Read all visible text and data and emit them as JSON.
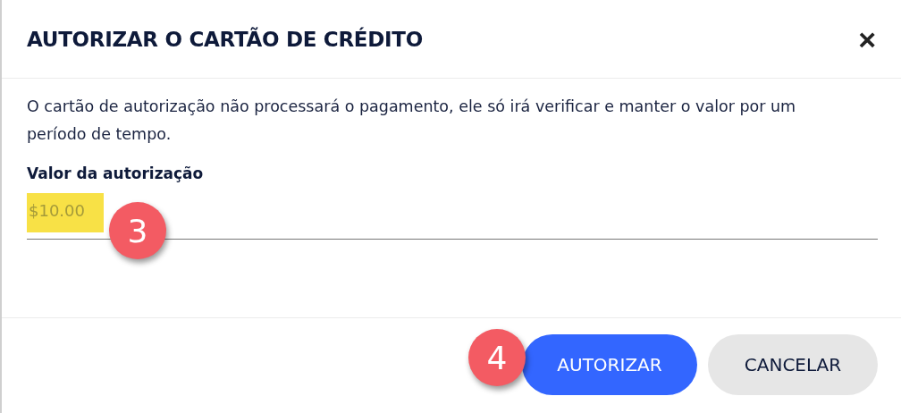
{
  "dialog": {
    "title": "AUTORIZAR O CARTÃO DE CRÉDITO",
    "close": "×"
  },
  "description": "O cartão de autorização não processará o pagamento, ele só irá verificar e manter o valor por um período de tempo.",
  "amount_field": {
    "label": "Valor da autorização",
    "placeholder": "$10.00",
    "highlighted": true,
    "callout": "3"
  },
  "footer_callout": "4",
  "buttons": [
    {
      "label": "AUTORIZAR",
      "kind": "primary"
    },
    {
      "label": "CANCELAR",
      "kind": "secondary"
    }
  ]
}
